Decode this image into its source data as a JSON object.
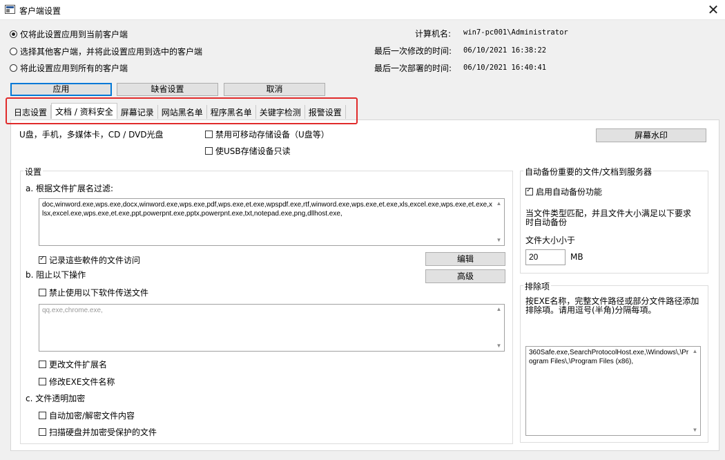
{
  "window": {
    "title": "客户端设置",
    "close_symbol": "✕"
  },
  "scope_options": [
    {
      "label": "仅将此设置应用到当前客户端",
      "checked": true
    },
    {
      "label": "选择其他客户端，并将此设置应用到选中的客户端",
      "checked": false
    },
    {
      "label": "将此设置应用到所有的客户端",
      "checked": false
    }
  ],
  "info": {
    "computer_label": "计算机名:",
    "computer_value": "win7-pc001\\Administrator",
    "modified_label": "最后一次修改的时间:",
    "modified_value": "06/10/2021 16:38:22",
    "deployed_label": "最后一次部署的时间:",
    "deployed_value": "06/10/2021 16:40:41"
  },
  "buttons": {
    "apply": "应用",
    "default": "缺省设置",
    "cancel": "取消"
  },
  "tabs": [
    {
      "label": "日志设置",
      "active": false
    },
    {
      "label": "文档 / 资料安全",
      "active": true
    },
    {
      "label": "屏幕记录",
      "active": false
    },
    {
      "label": "网站黑名单",
      "active": false
    },
    {
      "label": "程序黑名单",
      "active": false
    },
    {
      "label": "关键字检测",
      "active": false
    },
    {
      "label": "报警设置",
      "active": false
    }
  ],
  "device": {
    "media_label": "U盘，手机，多媒体卡，CD / DVD光盘",
    "disable_removable": "禁用可移动存储设备（U盘等）",
    "usb_readonly": "使USB存储设备只读",
    "watermark_button": "屏幕水印"
  },
  "settings": {
    "group_title": "设置",
    "filter_label": "a. 根据文件扩展名过滤:",
    "filter_text": "doc,winword.exe,wps.exe,docx,winword.exe,wps.exe,pdf,wps.exe,et.exe,wpspdf.exe,rtf,winword.exe,wps.exe,et.exe,xls,excel.exe,wps.exe,et.exe,xlsx,excel.exe,wps.exe,et.exe,ppt,powerpnt.exe,pptx,powerpnt.exe,txt,notepad.exe,png,dllhost.exe,",
    "record_access": "记录這些軟件的文件访问",
    "edit_button": "编辑",
    "advanced_button": "高级",
    "block_label": "b. 阻止以下操作",
    "block_transfer": "禁止使用以下软件传送文件",
    "block_transfer_placeholder": "qq.exe,chrome.exe,",
    "change_ext": "更改文件扩展名",
    "rename_exe": "修改EXE文件名称",
    "encrypt_label": "c. 文件透明加密",
    "auto_encrypt": "自动加密/解密文件内容",
    "scan_disk": "扫描硬盘并加密受保护的文件"
  },
  "backup": {
    "group_title": "自动备份重要的文件/文档到服务器",
    "enable": "启用自动备份功能",
    "desc": "当文件类型匹配，并且文件大小满足以下要求时自动备份",
    "size_label": "文件大小小于",
    "size_value": "20",
    "size_unit": "MB"
  },
  "exclusions": {
    "group_title": "排除项",
    "desc": "按EXE名称，完整文件路径或部分文件路径添加排除項。请用逗号(半角)分隔每項。",
    "list_text": "360Safe.exe,SearchProtocolHost.exe,\\Windows\\,\\Program Files\\,\\Program Files (x86),"
  },
  "colors": {
    "highlight": "#e02a2a",
    "accent": "#0078d7"
  }
}
